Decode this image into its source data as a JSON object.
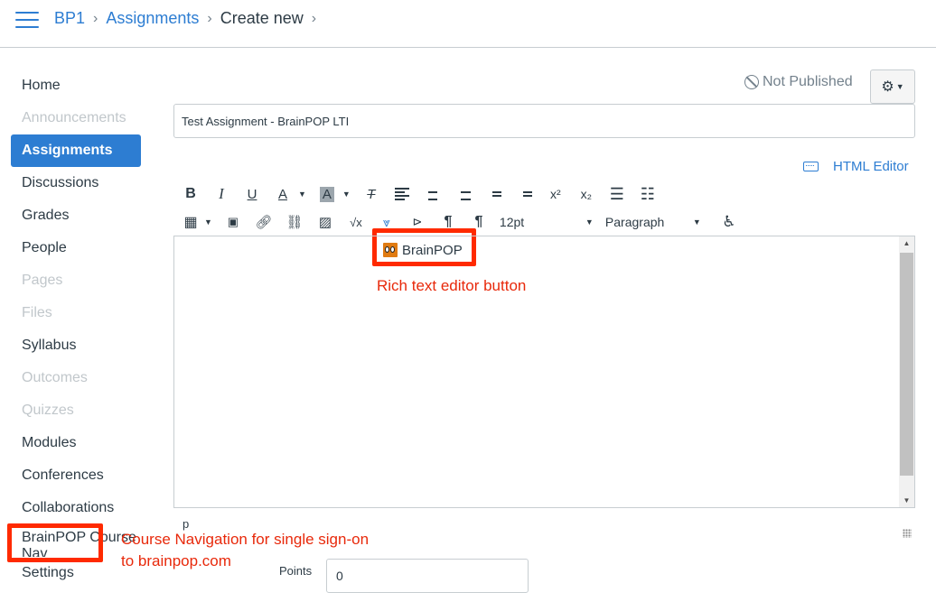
{
  "breadcrumbs": [
    {
      "label": "BP1"
    },
    {
      "label": "Assignments"
    },
    {
      "label": "Create new"
    }
  ],
  "sidebar": {
    "items": [
      {
        "label": "Home",
        "state": "enabled"
      },
      {
        "label": "Announcements",
        "state": "disabled"
      },
      {
        "label": "Assignments",
        "state": "active"
      },
      {
        "label": "Discussions",
        "state": "enabled"
      },
      {
        "label": "Grades",
        "state": "enabled"
      },
      {
        "label": "People",
        "state": "enabled"
      },
      {
        "label": "Pages",
        "state": "disabled"
      },
      {
        "label": "Files",
        "state": "disabled"
      },
      {
        "label": "Syllabus",
        "state": "enabled"
      },
      {
        "label": "Outcomes",
        "state": "disabled"
      },
      {
        "label": "Quizzes",
        "state": "disabled"
      },
      {
        "label": "Modules",
        "state": "enabled"
      },
      {
        "label": "Conferences",
        "state": "enabled"
      },
      {
        "label": "Collaborations",
        "state": "enabled"
      },
      {
        "label": "BrainPOP Course Nav",
        "state": "enabled"
      },
      {
        "label": "Settings",
        "state": "enabled"
      }
    ]
  },
  "publish_status": "Not Published",
  "assignment": {
    "title": "Test Assignment - BrainPOP LTI",
    "points_label": "Points",
    "points_value": "0"
  },
  "html_editor_label": "HTML Editor",
  "toolbar": {
    "bold": "B",
    "italic": "I",
    "underline": "U",
    "font_color": "A",
    "bg_color": "A",
    "clear_format": "T",
    "superscript": "x²",
    "subscript": "x₂",
    "math": "√x",
    "ltr": "¶",
    "rtl": "¶",
    "font_size": "12pt",
    "block_format": "Paragraph"
  },
  "editor": {
    "brainpop_button": "BrainPOP",
    "status_path": "p"
  },
  "annotations": {
    "rce_button": "Rich text editor button",
    "course_nav": "Course Navigation for single sign-on to brainpop.com"
  },
  "colors": {
    "accent": "#2d7dd2",
    "annotation": "#ff2a00",
    "brainpop_orange": "#e07b12"
  }
}
